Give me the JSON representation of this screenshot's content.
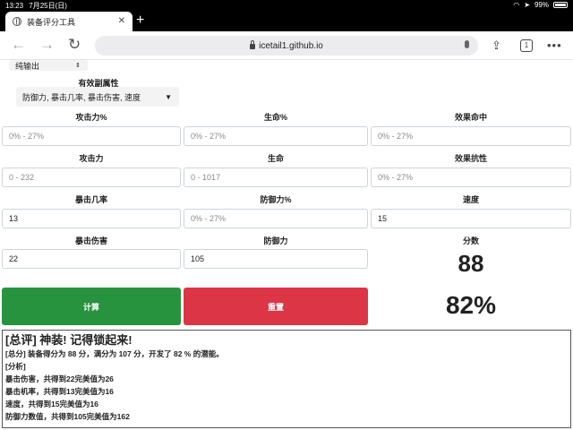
{
  "status_bar": {
    "time": "13:23",
    "date": "7月25日(日)",
    "battery": "99%"
  },
  "browser": {
    "tab_title": "装备评分工具",
    "url": "icetail1.github.io",
    "tab_count": "1"
  },
  "form": {
    "output_select": "纯输出",
    "effective_label": "有效副属性",
    "effective_value": "防御力, 暴击几率, 暴击伤害, 速度",
    "rows": [
      [
        {
          "label": "攻击力%",
          "value": "",
          "placeholder": "0% - 27%"
        },
        {
          "label": "生命%",
          "value": "",
          "placeholder": "0% - 27%"
        },
        {
          "label": "效果命中",
          "value": "",
          "placeholder": "0% - 27%"
        }
      ],
      [
        {
          "label": "攻击力",
          "value": "",
          "placeholder": "0 - 232"
        },
        {
          "label": "生命",
          "value": "",
          "placeholder": "0 - 1017"
        },
        {
          "label": "效果抗性",
          "value": "",
          "placeholder": "0% - 27%"
        }
      ],
      [
        {
          "label": "暴击几率",
          "value": "13",
          "placeholder": ""
        },
        {
          "label": "防御力%",
          "value": "",
          "placeholder": "0% - 27%"
        },
        {
          "label": "速度",
          "value": "15",
          "placeholder": ""
        }
      ],
      [
        {
          "label": "暴击伤害",
          "value": "22",
          "placeholder": ""
        },
        {
          "label": "防御力",
          "value": "105",
          "placeholder": ""
        }
      ]
    ],
    "score_label": "分数",
    "score": "88",
    "percent": "82%",
    "calc_button": "计算",
    "reset_button": "重置",
    "colors": {
      "calc": "#28933f",
      "reset": "#dc3545"
    }
  },
  "result": {
    "title": "[总评] 神装! 记得锁起来!",
    "lines": [
      "[总分] 装备得分为 88 分，满分为 107 分，开发了 82 % 的潜能。",
      "[分析]",
      "暴击伤害，共得到22完美值为26",
      "暴击机率，共得到13完美值为16",
      "速度，共得到15完美值为16",
      "防御力数值，共得到105完美值为162"
    ]
  }
}
